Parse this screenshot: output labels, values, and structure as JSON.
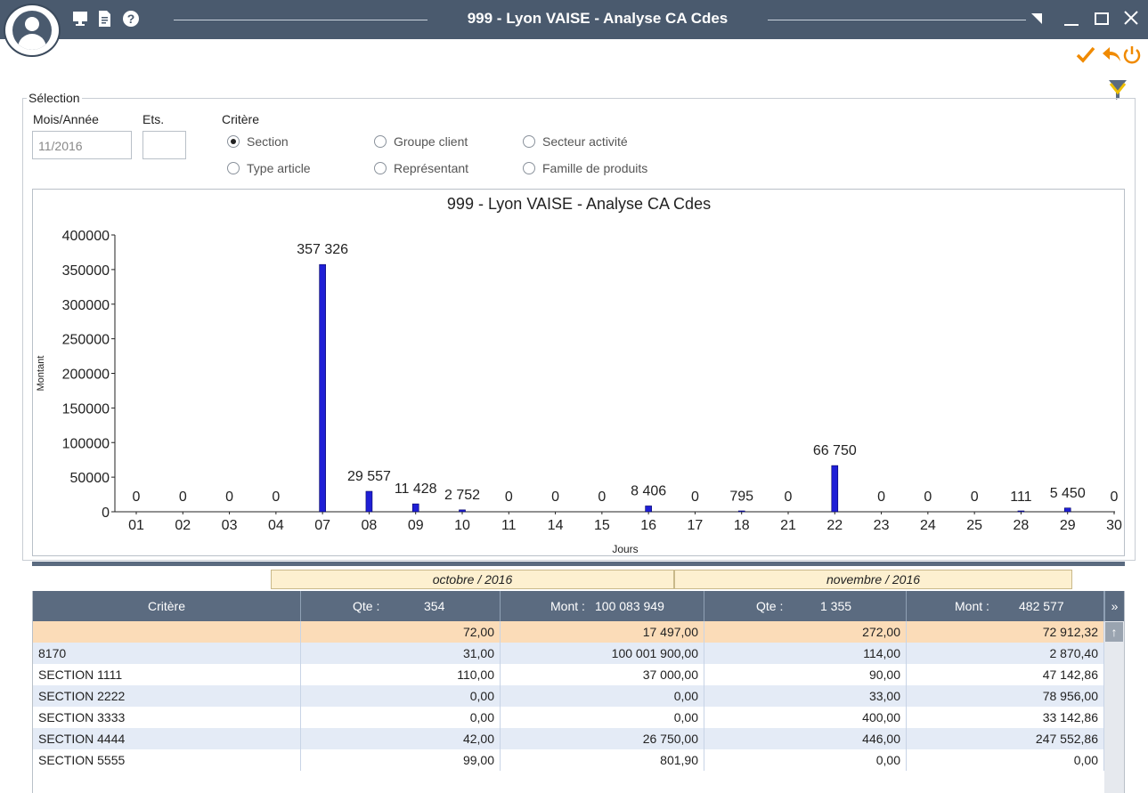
{
  "window": {
    "title": "999 - Lyon VAISE - Analyse CA Cdes"
  },
  "titlebar_icons": [
    "user-avatar-icon",
    "monitor-icon",
    "document-icon",
    "help-icon"
  ],
  "window_controls": [
    "restore-corner-icon",
    "minimize-icon",
    "maximize-icon",
    "close-icon"
  ],
  "actions": {
    "validate_icon": "check-icon",
    "back_icon": "reply-arrow-icon",
    "power_icon": "power-icon",
    "filter_icon": "filter-icon"
  },
  "colors": {
    "titlebar": "#4a5a6e",
    "accent": "#f08a00",
    "bar": "#1f1fd6",
    "grid_header": "#5b6b80",
    "highlight_row": "#fbdcb8",
    "alt_row": "#e4ebf6"
  },
  "selection": {
    "legend": "Sélection",
    "mois_label": "Mois/Année",
    "mois_value": "11/2016",
    "ets_label": "Ets.",
    "ets_value": "",
    "critere_label": "Critère",
    "options": [
      {
        "label": "Section",
        "checked": true
      },
      {
        "label": "Groupe client",
        "checked": false
      },
      {
        "label": "Secteur activité",
        "checked": false
      },
      {
        "label": "Type article",
        "checked": false
      },
      {
        "label": "Représentant",
        "checked": false
      },
      {
        "label": "Famille de produits",
        "checked": false
      }
    ]
  },
  "chart_data": {
    "type": "bar",
    "title": "999 - Lyon VAISE - Analyse CA Cdes",
    "xlabel": "Jours",
    "ylabel": "Montant",
    "ylim": [
      0,
      400000
    ],
    "yticks": [
      "0",
      "50000",
      "100000",
      "150000",
      "200000",
      "250000",
      "300000",
      "350000",
      "400000"
    ],
    "categories": [
      "01",
      "02",
      "03",
      "04",
      "07",
      "08",
      "09",
      "10",
      "11",
      "14",
      "15",
      "16",
      "17",
      "18",
      "21",
      "22",
      "23",
      "24",
      "25",
      "28",
      "29",
      "30"
    ],
    "values": [
      0,
      0,
      0,
      0,
      357326,
      29557,
      11428,
      2752,
      0,
      0,
      0,
      8406,
      0,
      795,
      0,
      66750,
      0,
      0,
      0,
      111,
      5450,
      0
    ],
    "value_labels": [
      "0",
      "0",
      "0",
      "0",
      "357 326",
      "29 557",
      "11 428",
      "2 752",
      "0",
      "0",
      "0",
      "8 406",
      "0",
      "795",
      "0",
      "66 750",
      "0",
      "0",
      "0",
      "111",
      "5 450",
      "0"
    ]
  },
  "months": {
    "left": "octobre / 2016",
    "right": "novembre / 2016"
  },
  "grid": {
    "headers": {
      "critere": "Critère",
      "qte1_label": "Qte :",
      "qte1_value": "354",
      "mont1_label": "Mont :",
      "mont1_value": "100 083 949",
      "qte2_label": "Qte :",
      "qte2_value": "1 355",
      "mont2_label": "Mont :",
      "mont2_value": "482 577"
    },
    "rows": [
      {
        "critere": "",
        "qte1": "72,00",
        "mont1": "17 497,00",
        "qte2": "272,00",
        "mont2": "72 912,32"
      },
      {
        "critere": "8170",
        "qte1": "31,00",
        "mont1": "100 001 900,00",
        "qte2": "114,00",
        "mont2": "2 870,40"
      },
      {
        "critere": "SECTION 1111",
        "qte1": "110,00",
        "mont1": "37 000,00",
        "qte2": "90,00",
        "mont2": "47 142,86"
      },
      {
        "critere": "SECTION 2222",
        "qte1": "0,00",
        "mont1": "0,00",
        "qte2": "33,00",
        "mont2": "78 956,00"
      },
      {
        "critere": "SECTION 3333",
        "qte1": "0,00",
        "mont1": "0,00",
        "qte2": "400,00",
        "mont2": "33 142,86"
      },
      {
        "critere": "SECTION 4444",
        "qte1": "42,00",
        "mont1": "26 750,00",
        "qte2": "446,00",
        "mont2": "247 552,86"
      },
      {
        "critere": "SECTION 5555",
        "qte1": "99,00",
        "mont1": "801,90",
        "qte2": "0,00",
        "mont2": "0,00"
      }
    ]
  }
}
